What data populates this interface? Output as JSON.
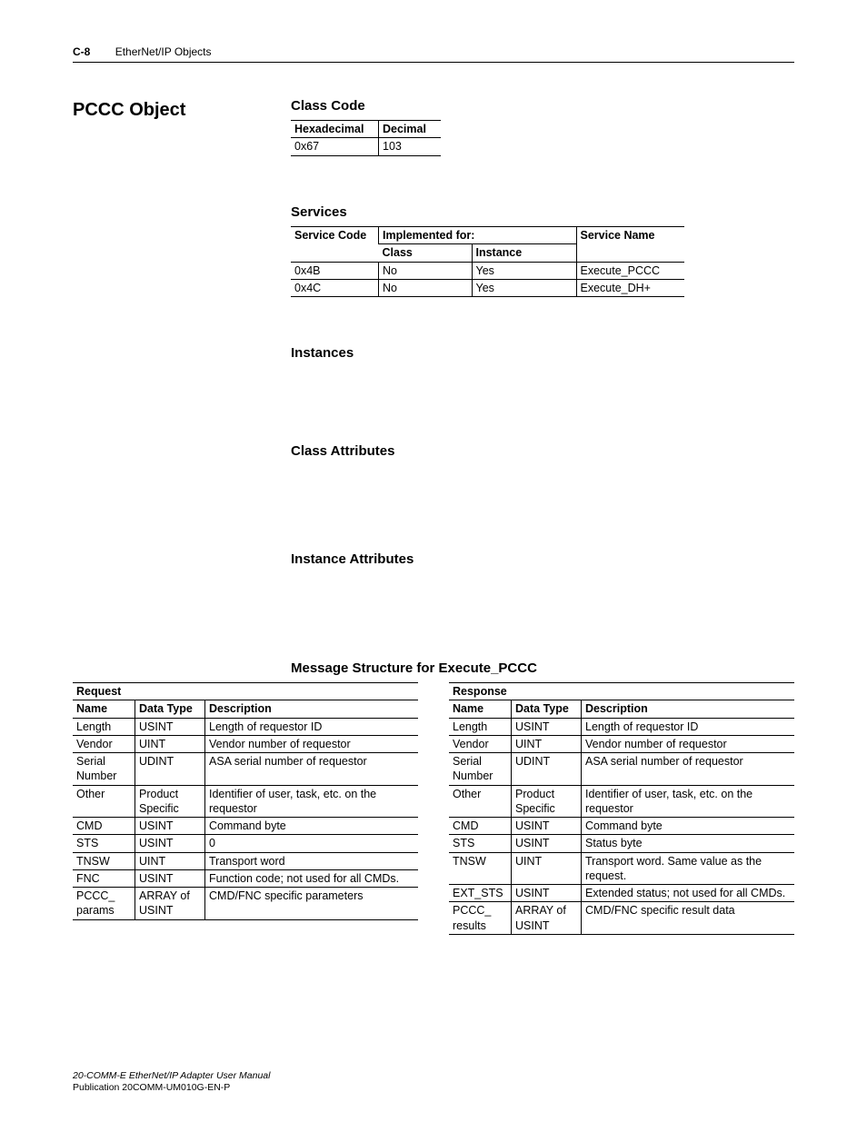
{
  "header": {
    "page_num": "C-8",
    "section": "EtherNet/IP Objects"
  },
  "title_left": "PCCC Object",
  "class_code": {
    "heading": "Class Code",
    "cols": [
      "Hexadecimal",
      "Decimal"
    ],
    "row": [
      "0x67",
      "103"
    ]
  },
  "services": {
    "heading": "Services",
    "top_cols": {
      "sc": "Service Code",
      "impl": "Implemented for:",
      "sn": "Service Name"
    },
    "sub_cols": {
      "cls": "Class",
      "inst": "Instance"
    },
    "rows": [
      {
        "code": "0x4B",
        "cls": "No",
        "inst": "Yes",
        "name": "Execute_PCCC"
      },
      {
        "code": "0x4C",
        "cls": "No",
        "inst": "Yes",
        "name": "Execute_DH+"
      }
    ]
  },
  "instances_heading": "Instances",
  "class_attr_heading": "Class Attributes",
  "inst_attr_heading": "Instance Attributes",
  "msg_heading": "Message Structure for Execute_PCCC",
  "msg": {
    "cols": {
      "name": "Name",
      "dt": "Data Type",
      "desc": "Description"
    },
    "request": {
      "title": "Request",
      "rows": [
        {
          "name": "Length",
          "dt": "USINT",
          "desc": "Length of requestor ID"
        },
        {
          "name": "Vendor",
          "dt": "UINT",
          "desc": "Vendor number of requestor"
        },
        {
          "name": "Serial Number",
          "dt": "UDINT",
          "desc": "ASA serial number of requestor"
        },
        {
          "name": "Other",
          "dt": "Product Specific",
          "desc": "Identifier of user, task, etc. on the requestor"
        },
        {
          "name": "CMD",
          "dt": "USINT",
          "desc": "Command byte"
        },
        {
          "name": "STS",
          "dt": "USINT",
          "desc": "0"
        },
        {
          "name": "TNSW",
          "dt": "UINT",
          "desc": "Transport word"
        },
        {
          "name": "FNC",
          "dt": "USINT",
          "desc": "Function code; not used for all CMDs."
        },
        {
          "name": "PCCC_ params",
          "dt": "ARRAY of USINT",
          "desc": "CMD/FNC specific parameters"
        }
      ]
    },
    "response": {
      "title": "Response",
      "rows": [
        {
          "name": "Length",
          "dt": "USINT",
          "desc": "Length of requestor ID"
        },
        {
          "name": "Vendor",
          "dt": "UINT",
          "desc": "Vendor number of requestor"
        },
        {
          "name": "Serial Number",
          "dt": "UDINT",
          "desc": "ASA serial number of requestor"
        },
        {
          "name": "Other",
          "dt": "Product Specific",
          "desc": "Identifier of user, task, etc. on the requestor"
        },
        {
          "name": "CMD",
          "dt": "USINT",
          "desc": "Command byte"
        },
        {
          "name": "STS",
          "dt": "USINT",
          "desc": "Status byte"
        },
        {
          "name": "TNSW",
          "dt": "UINT",
          "desc": "Transport word. Same value as the request."
        },
        {
          "name": "EXT_STS",
          "dt": "USINT",
          "desc": "Extended status; not used for all CMDs."
        },
        {
          "name": "PCCC_ results",
          "dt": "ARRAY of USINT",
          "desc": "CMD/FNC specific result data"
        }
      ]
    }
  },
  "footer": {
    "line1": "20-COMM-E EtherNet/IP Adapter User Manual",
    "line2": "Publication 20COMM-UM010G-EN-P"
  }
}
